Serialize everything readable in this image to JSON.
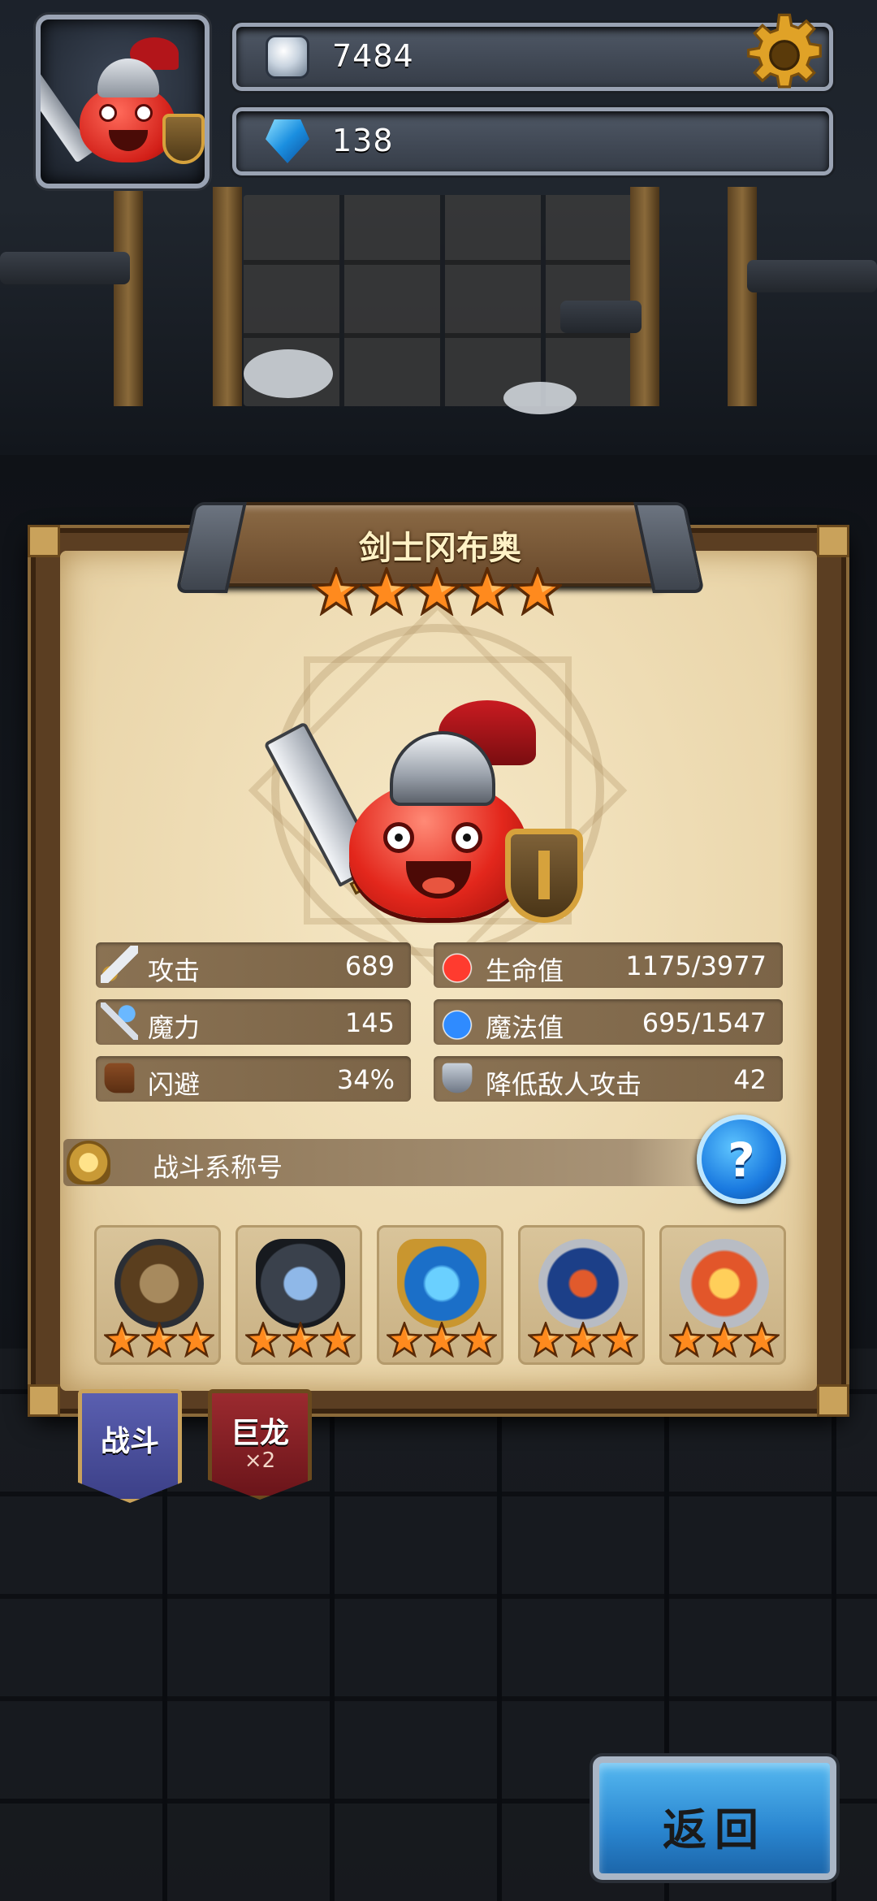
{
  "hud": {
    "coins": "7484",
    "gems": "138",
    "icons": {
      "avatar": "hero-portrait",
      "coins": "silver-coin-icon",
      "gems": "blue-gem-icon",
      "settings": "gear-icon"
    }
  },
  "hero": {
    "name": "剑士冈布奥",
    "star_count": 5,
    "stats_left": [
      {
        "icon": "sword-icon",
        "label": "攻击",
        "value": "689"
      },
      {
        "icon": "wand-icon",
        "label": "魔力",
        "value": "145"
      },
      {
        "icon": "boot-icon",
        "label": "闪避",
        "value": "34%"
      }
    ],
    "stats_right": [
      {
        "icon": "red-potion-icon",
        "label": "生命值",
        "value": "1175/3977"
      },
      {
        "icon": "blue-potion-icon",
        "label": "魔法值",
        "value": "695/1547"
      },
      {
        "icon": "shield-icon",
        "label": "降低敌人攻击",
        "value": "42"
      }
    ],
    "title_row_label": "战斗系称号",
    "help_label": "?",
    "equipment": [
      {
        "name": "spear-round-shield",
        "stars": 3
      },
      {
        "name": "spear-steel-shield",
        "stars": 3
      },
      {
        "name": "blue-wave-shield",
        "stars": 3
      },
      {
        "name": "laurel-sword-crest",
        "stars": 3
      },
      {
        "name": "crowned-dragon-crest",
        "stars": 3
      }
    ]
  },
  "tabs": [
    {
      "label": "战斗",
      "sub": ""
    },
    {
      "label": "巨龙",
      "sub": "×2"
    }
  ],
  "back_button": {
    "label": "返回"
  },
  "colors": {
    "star": "#ff8a1e",
    "gold": "#d6a23c",
    "parchment": "#f0dfb8",
    "stat_bar": "#7b6447",
    "tab_blue": "#4b4f9a",
    "tab_red": "#8a2126",
    "back_blue": "#2a86d0"
  }
}
